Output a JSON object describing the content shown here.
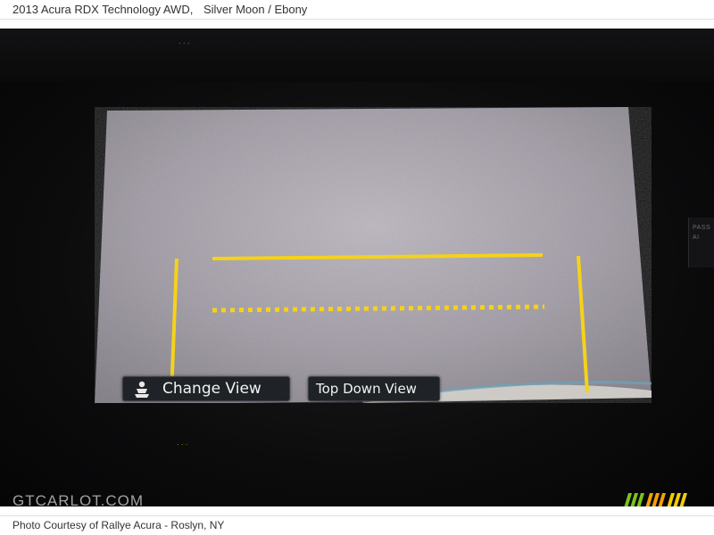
{
  "caption": {
    "vehicle": "2013 Acura RDX Technology AWD,",
    "color": "Silver Moon / Ebony"
  },
  "screen": {
    "change_view_label": "Change View",
    "top_down_view_label": "Top Down View",
    "guide_line_color": "#f5d21a",
    "change_view_icon": "seat-view-icon"
  },
  "dash": {
    "passenger_badge": "PASS\nAI"
  },
  "watermark": "GTCARLOT.COM",
  "credit": "Photo Courtesy of Rallye Acura - Roslyn, NY",
  "logo": {
    "stripe_colors": [
      "#7cc21c",
      "#f6a000",
      "#f2cc00"
    ]
  }
}
